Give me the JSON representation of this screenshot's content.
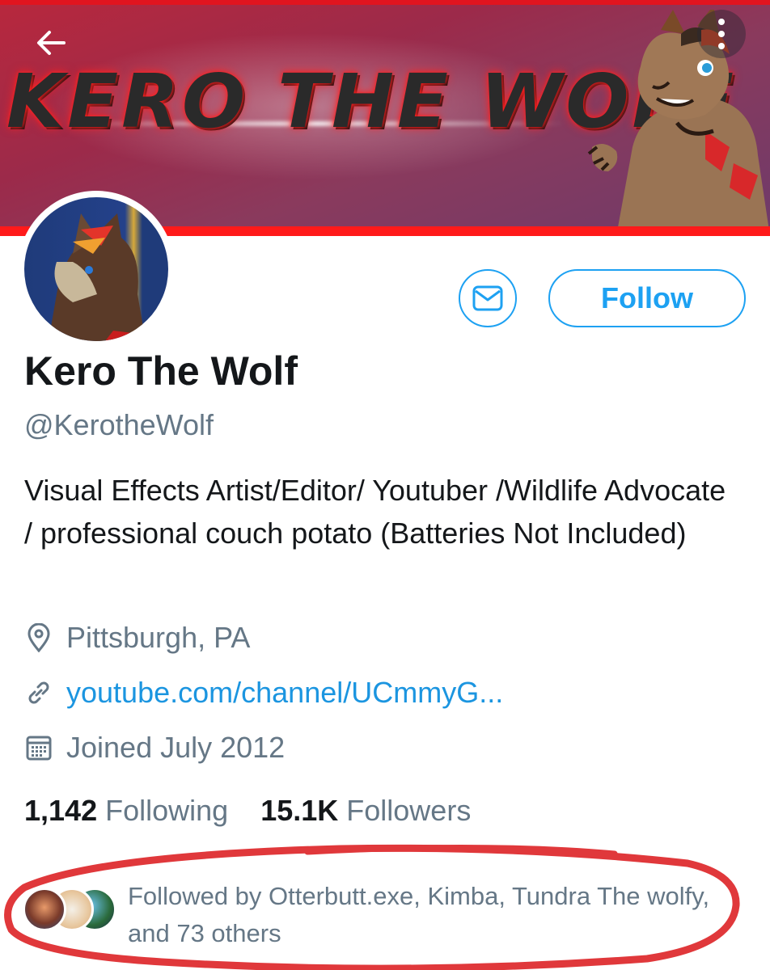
{
  "banner": {
    "title": "KERO THE WOLF",
    "accent_color": "#e1141f"
  },
  "header": {
    "back_icon": "arrow-left-icon",
    "menu_icon": "more-vertical-icon"
  },
  "profile": {
    "display_name": "Kero The Wolf",
    "handle": "@KerotheWolf",
    "bio": "Visual Effects Artist/Editor/ Youtuber /Wildlife Advocate / professional couch potato (Batteries Not Included)",
    "location": "Pittsburgh, PA",
    "website": "youtube.com/channel/UCmmyG...",
    "joined": "Joined July 2012"
  },
  "actions": {
    "message_icon": "envelope-icon",
    "follow_label": "Follow",
    "accent_color": "#1da1f2"
  },
  "stats": {
    "following_count": "1,142",
    "following_label": "Following",
    "followers_count": "15.1K",
    "followers_label": "Followers"
  },
  "followed_by": {
    "text": "Followed by Otterbutt.exe, Kimba, Tundra The wolfy, and 73 others"
  },
  "annotation": {
    "color": "#e0383b"
  }
}
